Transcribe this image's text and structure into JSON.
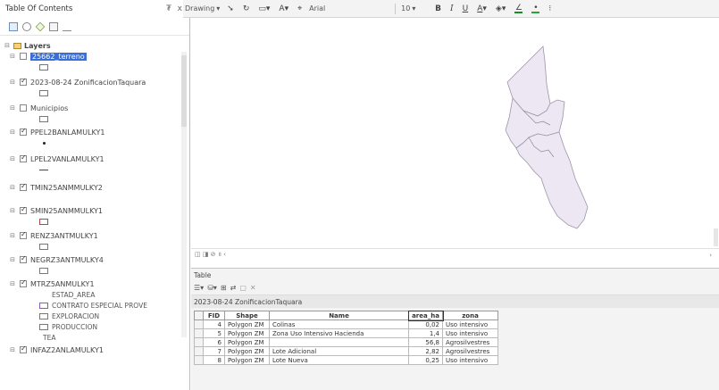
{
  "toolbar": {
    "drawing_label": "Drawing",
    "font_label": "Arial",
    "size_label": "10",
    "bold": "B",
    "italic": "I",
    "underline": "U",
    "font_color_label": "A",
    "fill_color": "#2aa33a",
    "line_color": "#1a8a2a"
  },
  "toc": {
    "title": "Table Of Contents",
    "pin": "₮ x",
    "layers_label": "Layers",
    "items": [
      {
        "name": "25662_terreno",
        "checked": false,
        "selected": true
      },
      {
        "name": "2023-08-24 ZonificacionTaquara",
        "checked": true,
        "selected": false
      },
      {
        "name": "Municipios",
        "checked": false,
        "selected": false
      },
      {
        "name": "PPEL2BANLAMULKY1",
        "checked": true,
        "selected": false
      },
      {
        "name": "LPEL2VANLAMULKY1",
        "checked": true,
        "selected": false
      },
      {
        "name": "TMIN25ANMMULKY2",
        "checked": true,
        "selected": false
      },
      {
        "name": "SMIN25ANMMULKY1",
        "checked": true,
        "selected": false
      },
      {
        "name": "RENZ3ANTMULKY1",
        "checked": true,
        "selected": false
      },
      {
        "name": "NEGRZ3ANTMULKY4",
        "checked": true,
        "selected": false
      },
      {
        "name": "MTRZ5ANMULKY1",
        "checked": true,
        "selected": false
      },
      {
        "name": "INFAZ2ANLAMULKY1",
        "checked": true,
        "selected": false
      }
    ],
    "estad_area": "ESTAD_AREA",
    "sublegend": [
      "CONTRATO ESPECIAL PROVE",
      "EXPLORACION",
      "PRODUCCION",
      "TEA"
    ]
  },
  "map": {
    "status": "◫ ◨ ⊘ ॥ ‹",
    "scroll_right": "›"
  },
  "table": {
    "title": "Table",
    "tab_label": "2023-08-24 ZonificacionTaquara",
    "columns": [
      "FID",
      "Shape",
      "Name",
      "area_ha",
      "zona"
    ],
    "rows": [
      {
        "fid": "4",
        "shape": "Polygon ZM",
        "name": "Colinas",
        "area": "0,02",
        "zona": "Uso intensivo"
      },
      {
        "fid": "5",
        "shape": "Polygon ZM",
        "name": "Zona Uso Intensivo Hacienda",
        "area": "1,4",
        "zona": "Uso intensivo"
      },
      {
        "fid": "6",
        "shape": "Polygon ZM",
        "name": "",
        "area": "56,8",
        "zona": "Agrosilvestres"
      },
      {
        "fid": "7",
        "shape": "Polygon ZM",
        "name": "Lote Adicional",
        "area": "2,82",
        "zona": "Agrosilvestres"
      },
      {
        "fid": "8",
        "shape": "Polygon ZM",
        "name": "Lote Nueva",
        "area": "0,25",
        "zona": "Uso intensivo"
      }
    ]
  }
}
